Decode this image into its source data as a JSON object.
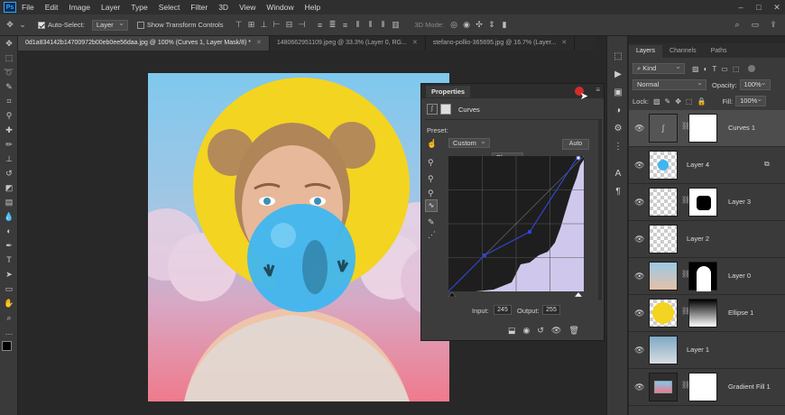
{
  "menubar": {
    "logo": "Ps",
    "items": [
      "File",
      "Edit",
      "Image",
      "Layer",
      "Type",
      "Select",
      "Filter",
      "3D",
      "View",
      "Window",
      "Help"
    ],
    "window_controls": [
      "–",
      "□",
      "✕"
    ]
  },
  "options": {
    "auto_select_label": "Auto-Select:",
    "auto_select_value": "Layer",
    "show_transform_label": "Show Transform Controls",
    "mode_3d_label": "3D Mode:"
  },
  "tabs": [
    {
      "label": "0d1a834142b14700972b00eb0ee56daa.jpg @ 100% (Curves 1, Layer Mask/8) *",
      "active": true
    },
    {
      "label": "1480662951109.jpeg @ 33.3% (Layer 0, RG...",
      "active": false
    },
    {
      "label": "stefano-pollio-365695.jpg @ 16.7% (Layer...",
      "active": false
    }
  ],
  "properties": {
    "title": "Properties",
    "adjustment": "Curves",
    "preset_label": "Preset:",
    "preset_value": "Custom",
    "channel_value": "Blue",
    "auto_label": "Auto",
    "input_label": "Input:",
    "input_value": "245",
    "output_label": "Output:",
    "output_value": "255"
  },
  "layers_panel": {
    "tabs": [
      "Layers",
      "Channels",
      "Paths"
    ],
    "kind_label": "Kind",
    "blend_mode": "Normal",
    "opacity_label": "Opacity:",
    "opacity_value": "100%",
    "lock_label": "Lock:",
    "fill_label": "Fill:",
    "fill_value": "100%",
    "layers": [
      {
        "name": "Curves 1",
        "selected": true
      },
      {
        "name": "Layer 4",
        "selected": false
      },
      {
        "name": "Layer 3",
        "selected": false
      },
      {
        "name": "Layer 2",
        "selected": false
      },
      {
        "name": "Layer 0",
        "selected": false
      },
      {
        "name": "Ellipse 1",
        "selected": false
      },
      {
        "name": "Layer 1",
        "selected": false
      },
      {
        "name": "Gradient Fill 1",
        "selected": false
      }
    ]
  },
  "colors": {
    "accent": "#31a8ff",
    "close": "#d42b2b",
    "sun": "#f3d421",
    "bubble": "#3fb6f0"
  }
}
